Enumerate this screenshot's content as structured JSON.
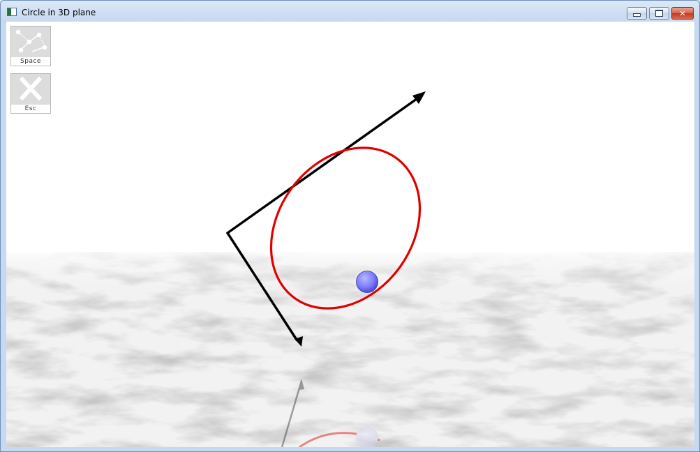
{
  "window": {
    "title": "Circle in 3D plane",
    "controls": {
      "minimize": "▭",
      "maximize": "□",
      "close": "✕"
    }
  },
  "toolbar": {
    "space_label": "Space",
    "esc_label": "Esc"
  },
  "scene": {
    "circle_color": "#e00000",
    "ball_color": "#7a7aff",
    "axis_color": "#000000",
    "floor": "marble",
    "sky_color": "#ffffff"
  }
}
